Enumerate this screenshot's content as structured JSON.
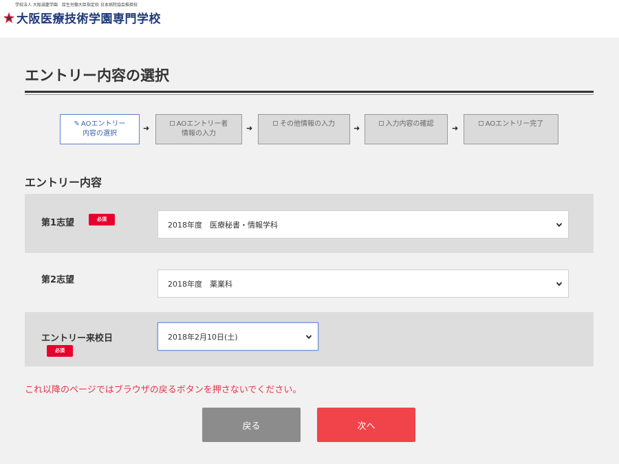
{
  "header": {
    "tagline": "学校法人 大阪滋慶学園　厚生労働大臣指定校 日本病院協会推奨校",
    "school_name": "大阪医療技術学園専門学校",
    "logo_icon": "star-logo-icon",
    "logo_colors": {
      "star": "#d61f2b",
      "accent": "#1e3a78"
    }
  },
  "page": {
    "title": "エントリー内容の選択"
  },
  "steps": [
    {
      "line1": "AOエントリー",
      "line2": "内容の選択",
      "icon": "edit-icon",
      "active": true
    },
    {
      "line1": "AOエントリー者",
      "line2": "情報の入力",
      "icon": "checkbox-icon",
      "active": false
    },
    {
      "line1": "その他情報の入力",
      "line2": "",
      "icon": "checkbox-icon",
      "active": false
    },
    {
      "line1": "入力内容の確認",
      "line2": "",
      "icon": "checkbox-icon",
      "active": false
    },
    {
      "line1": "AOエントリー完了",
      "line2": "",
      "icon": "checkbox-icon",
      "active": false
    }
  ],
  "form": {
    "section_title": "エントリー内容",
    "required_label": "必須",
    "first_choice": {
      "label": "第1志望",
      "value": "2018年度　医療秘書・情報学科",
      "required": true
    },
    "second_choice": {
      "label": "第2志望",
      "value": "2018年度　薬業科",
      "required": false
    },
    "visit_date": {
      "label": "エントリー来校日",
      "value": "2018年2月10日(土)",
      "required": true
    }
  },
  "warning": "これ以降のページではブラウザの戻るボタンを押さないでください。",
  "buttons": {
    "back_label": "戻る",
    "next_label": "次へ"
  },
  "colors": {
    "required_badge": "#e8002d",
    "next_button": "#f0434a",
    "back_button": "#8c8c8c",
    "warning_text": "#e8334a",
    "active_step": "#5a82c8"
  }
}
